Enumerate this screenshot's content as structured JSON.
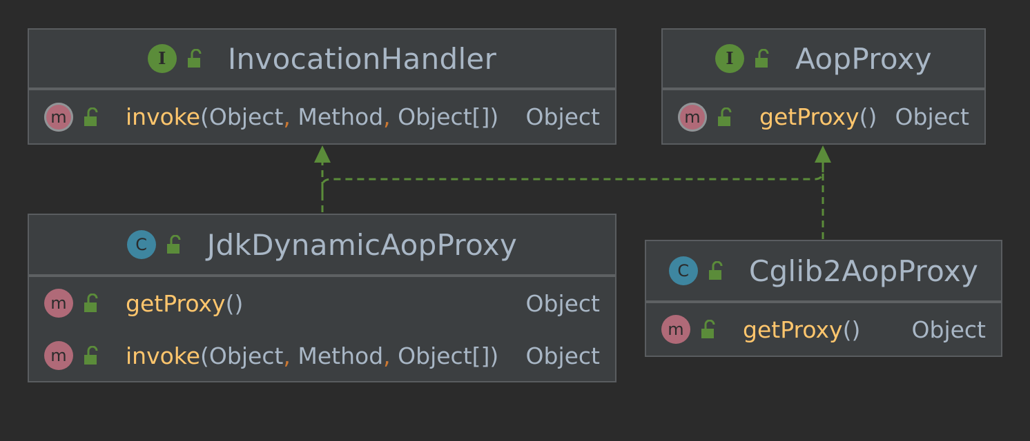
{
  "colors": {
    "background": "#2b2b2b",
    "box_fill": "#3c3f41",
    "box_border": "#5a5d60",
    "method_name": "#ffc66d",
    "text": "#a9b7c6",
    "comma": "#cc7832",
    "interface_badge": "#5b8c3a",
    "class_badge": "#3e86a0",
    "method_badge": "#b06a78",
    "arrow": "#5b8c3a"
  },
  "nodes": {
    "invocation_handler": {
      "kind": "interface",
      "badge": "I",
      "name": "InvocationHandler",
      "methods": [
        {
          "badge": "m",
          "name": "invoke",
          "open": "(",
          "p1": "Object",
          "c1": ",",
          "p2": " Method",
          "c2": ",",
          "p3": " Object[]",
          "close": ")",
          "return_type": "Object"
        }
      ]
    },
    "aop_proxy": {
      "kind": "interface",
      "badge": "I",
      "name": "AopProxy",
      "methods": [
        {
          "badge": "m",
          "name": "getProxy",
          "open": "(",
          "close": ")",
          "return_type": "Object"
        }
      ]
    },
    "jdk_dynamic_aop_proxy": {
      "kind": "class",
      "badge": "C",
      "name": "JdkDynamicAopProxy",
      "methods": [
        {
          "badge": "m",
          "name": "getProxy",
          "open": "(",
          "close": ")",
          "return_type": "Object"
        },
        {
          "badge": "m",
          "name": "invoke",
          "open": "(",
          "p1": "Object",
          "c1": ",",
          "p2": " Method",
          "c2": ",",
          "p3": " Object[]",
          "close": ")",
          "return_type": "Object"
        }
      ]
    },
    "cglib2_aop_proxy": {
      "kind": "class",
      "badge": "C",
      "name": "Cglib2AopProxy",
      "methods": [
        {
          "badge": "m",
          "name": "getProxy",
          "open": "(",
          "close": ")",
          "return_type": "Object"
        }
      ]
    }
  },
  "edges": [
    {
      "from": "JdkDynamicAopProxy",
      "to": "InvocationHandler",
      "type": "implements"
    },
    {
      "from": "JdkDynamicAopProxy",
      "to": "AopProxy",
      "type": "implements"
    },
    {
      "from": "Cglib2AopProxy",
      "to": "AopProxy",
      "type": "implements"
    }
  ]
}
